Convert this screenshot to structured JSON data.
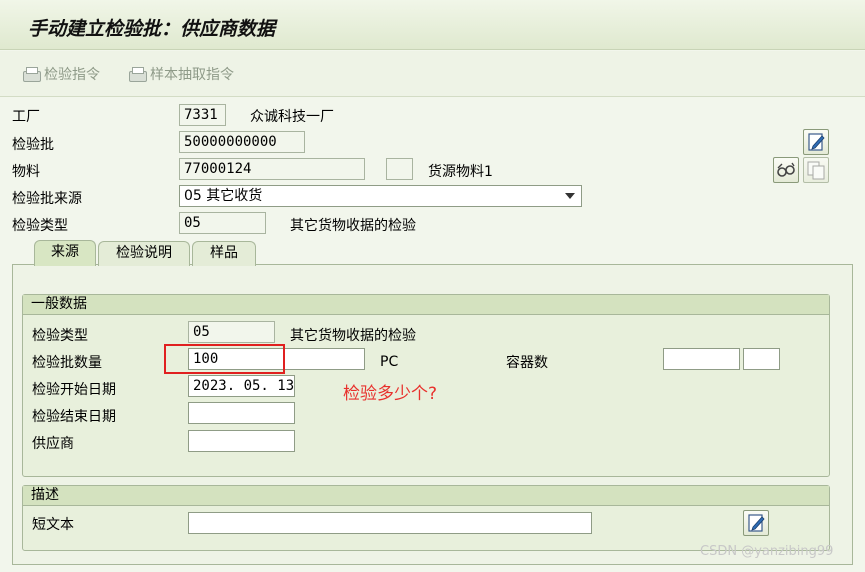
{
  "title": "手动建立检验批：供应商数据",
  "toolbar": {
    "inspection_spec": "检验指令",
    "sample_draw": "样本抽取指令"
  },
  "header": {
    "plant_label": "工厂",
    "plant_value": "7331",
    "plant_name": "众诚科技一厂",
    "lot_label": "检验批",
    "lot_value": "50000000000",
    "material_label": "物料",
    "material_value": "77000124",
    "source_material_label": "货源物料1",
    "origin_label": "检验批来源",
    "origin_value": "05 其它收货",
    "type_label": "检验类型",
    "type_value": "05",
    "type_desc": "其它货物收据的检验"
  },
  "tabs": [
    {
      "label": "来源"
    },
    {
      "label": "检验说明"
    },
    {
      "label": "样品"
    }
  ],
  "general": {
    "title": "一般数据",
    "type_label": "检验类型",
    "type_value": "05",
    "type_desc": "其它货物收据的检验",
    "qty_label": "检验批数量",
    "qty_value": "100",
    "qty_unit": "PC",
    "container_label": "容器数",
    "start_label": "检验开始日期",
    "start_value": "2023. 05. 13",
    "end_label": "检验结束日期",
    "end_value": "",
    "vendor_label": "供应商",
    "vendor_value": ""
  },
  "annotation": "检验多少个?",
  "description": {
    "title": "描述",
    "short_text_label": "短文本",
    "short_text_value": ""
  },
  "watermark": "CSDN @yanzibing99"
}
